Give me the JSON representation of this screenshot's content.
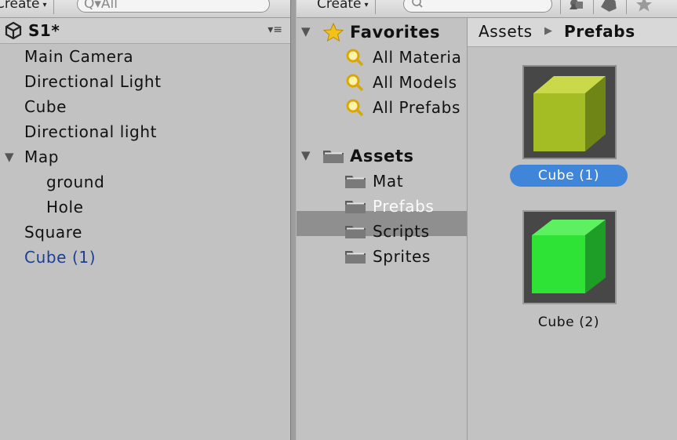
{
  "hierarchy": {
    "create_label": "Create",
    "search_placeholder": "Q▾All",
    "scene_name": "S1*",
    "items": [
      {
        "label": "Main Camera"
      },
      {
        "label": "Directional Light"
      },
      {
        "label": "Cube"
      },
      {
        "label": "Directional light"
      },
      {
        "label": "Map"
      },
      {
        "label": "ground"
      },
      {
        "label": "Hole"
      },
      {
        "label": "Square"
      },
      {
        "label": "Cube (1)"
      }
    ]
  },
  "project": {
    "create_label": "Create",
    "favorites": {
      "title": "Favorites",
      "items": [
        {
          "label": "All Materia"
        },
        {
          "label": "All Models"
        },
        {
          "label": "All Prefabs"
        }
      ]
    },
    "assets": {
      "title": "Assets",
      "items": [
        {
          "label": "Mat"
        },
        {
          "label": "Prefabs"
        },
        {
          "label": "Scripts"
        },
        {
          "label": "Sprites"
        }
      ]
    },
    "breadcrumb": {
      "root": "Assets",
      "current": "Prefabs"
    },
    "thumbnails": [
      {
        "label": "Cube (1)",
        "color": "#a9c42a",
        "selected": true
      },
      {
        "label": "Cube (2)",
        "color": "#2fe63a",
        "selected": false
      }
    ]
  },
  "colors": {
    "selection_blue": "#3f85d9",
    "selected_text": "#1d3e95",
    "panel_bg": "#c2c2c2"
  }
}
